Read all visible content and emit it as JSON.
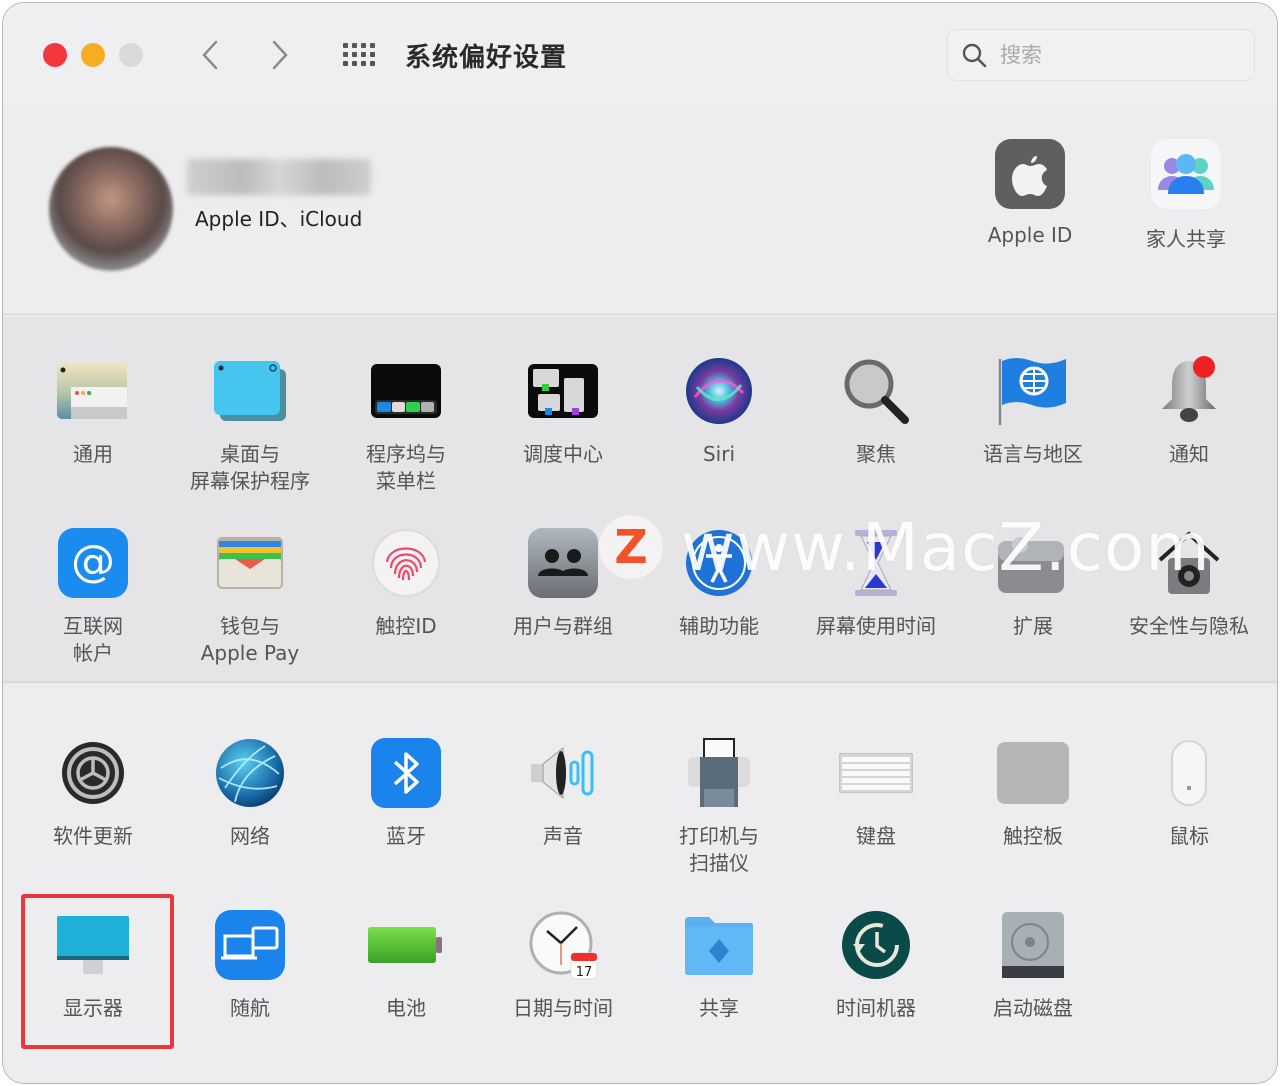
{
  "window": {
    "title": "系统偏好设置",
    "traffic_lights": {
      "close": "#f2383c",
      "minimize": "#f7ad22",
      "zoom": "#d9d8da"
    },
    "nav": {
      "back_icon": "chevron-left-icon",
      "forward_icon": "chevron-right-icon",
      "show_all_icon": "grid-icon"
    }
  },
  "search": {
    "placeholder": "搜索",
    "value": ""
  },
  "account": {
    "user_name": "",
    "subtitle": "Apple ID、iCloud",
    "shortcuts": [
      {
        "id": "apple-id",
        "label": "Apple ID",
        "icon": "apple-logo-icon"
      },
      {
        "id": "family-sharing",
        "label": "家人共享",
        "icon": "family-icon"
      }
    ]
  },
  "section1": {
    "row1": [
      {
        "id": "general",
        "label": "通用",
        "icon": "general-window-icon"
      },
      {
        "id": "desktop-screensaver",
        "label": "桌面与\n屏幕保护程序",
        "icon": "desktop-icon"
      },
      {
        "id": "dock-menubar",
        "label": "程序坞与\n菜单栏",
        "icon": "dock-icon"
      },
      {
        "id": "mission-control",
        "label": "调度中心",
        "icon": "mission-control-icon"
      },
      {
        "id": "siri",
        "label": "Siri",
        "icon": "siri-icon"
      },
      {
        "id": "spotlight",
        "label": "聚焦",
        "icon": "magnifier-icon"
      },
      {
        "id": "language-region",
        "label": "语言与地区",
        "icon": "flag-globe-icon"
      },
      {
        "id": "notifications",
        "label": "通知",
        "icon": "bell-icon"
      }
    ],
    "row2": [
      {
        "id": "internet-accounts",
        "label": "互联网\n帐户",
        "icon": "at-sign-icon"
      },
      {
        "id": "wallet-applepay",
        "label": "钱包与\nApple Pay",
        "icon": "wallet-icon"
      },
      {
        "id": "touch-id",
        "label": "触控ID",
        "icon": "fingerprint-icon"
      },
      {
        "id": "users-groups",
        "label": "用户与群组",
        "icon": "users-icon"
      },
      {
        "id": "accessibility",
        "label": "辅助功能",
        "icon": "accessibility-icon"
      },
      {
        "id": "screen-time",
        "label": "屏幕使用时间",
        "icon": "hourglass-icon"
      },
      {
        "id": "extensions",
        "label": "扩展",
        "icon": "puzzle-icon"
      },
      {
        "id": "security-privacy",
        "label": "安全性与隐私",
        "icon": "house-safe-icon"
      }
    ]
  },
  "section2": {
    "row1": [
      {
        "id": "software-update",
        "label": "软件更新",
        "icon": "gear-update-icon"
      },
      {
        "id": "network",
        "label": "网络",
        "icon": "network-globe-icon"
      },
      {
        "id": "bluetooth",
        "label": "蓝牙",
        "icon": "bluetooth-icon"
      },
      {
        "id": "sound",
        "label": "声音",
        "icon": "speaker-icon"
      },
      {
        "id": "printers-scanners",
        "label": "打印机与\n扫描仪",
        "icon": "printer-icon"
      },
      {
        "id": "keyboard",
        "label": "键盘",
        "icon": "keyboard-icon"
      },
      {
        "id": "trackpad",
        "label": "触控板",
        "icon": "trackpad-icon"
      },
      {
        "id": "mouse",
        "label": "鼠标",
        "icon": "mouse-icon"
      }
    ],
    "row2": [
      {
        "id": "displays",
        "label": "显示器",
        "icon": "monitor-icon",
        "highlighted": true
      },
      {
        "id": "sidecar",
        "label": "随航",
        "icon": "sidecar-icon"
      },
      {
        "id": "battery",
        "label": "电池",
        "icon": "battery-icon"
      },
      {
        "id": "date-time",
        "label": "日期与时间",
        "icon": "clock-calendar-icon",
        "calendar_day": "17"
      },
      {
        "id": "sharing",
        "label": "共享",
        "icon": "shared-folder-icon"
      },
      {
        "id": "time-machine",
        "label": "时间机器",
        "icon": "time-machine-icon"
      },
      {
        "id": "startup-disk",
        "label": "启动磁盘",
        "icon": "hard-disk-icon"
      }
    ]
  },
  "highlight": {
    "target": "displays",
    "color": "#e8383b"
  },
  "watermark": {
    "badge": "Z",
    "text": "www.MacZ.com"
  }
}
